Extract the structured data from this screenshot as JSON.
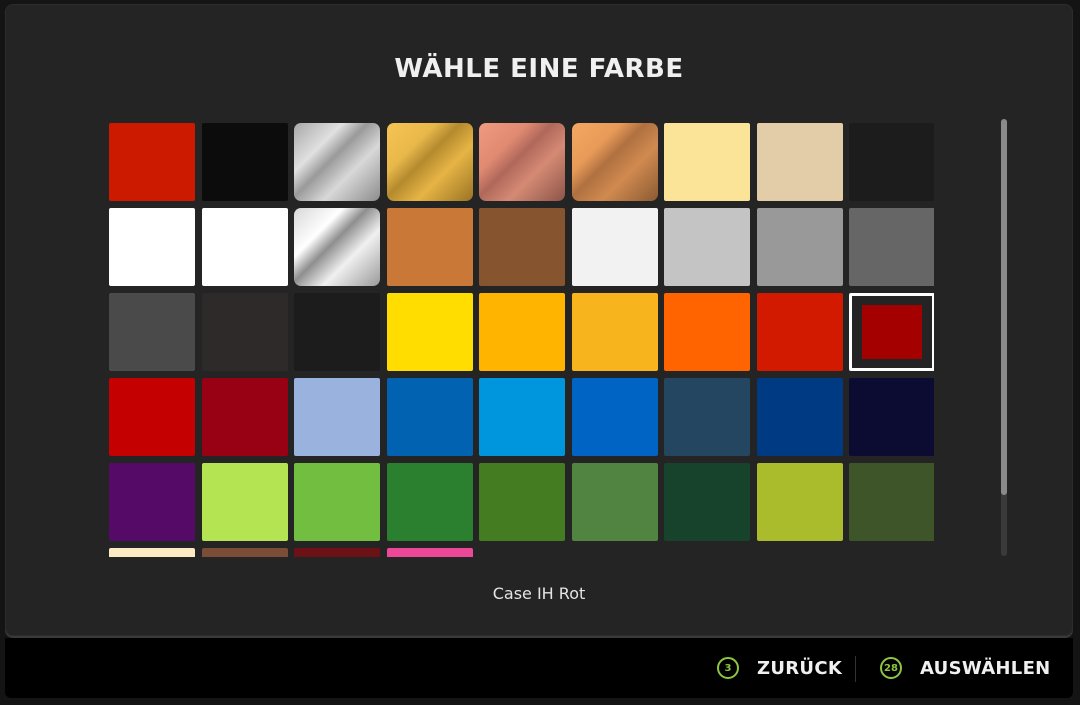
{
  "dialog": {
    "title": "WÄHLE EINE FARBE",
    "selected_color_name": "Case IH Rot",
    "selected_index": 26
  },
  "swatches": [
    {
      "color": "#cc1a00",
      "type": "solid"
    },
    {
      "color": "#0c0c0c",
      "type": "solid"
    },
    {
      "color": "silver",
      "type": "metallic",
      "gradient": [
        "#a8a8a8",
        "#e0e0e0",
        "#9a9a9a",
        "#d8d8d8",
        "#8c8c8c"
      ]
    },
    {
      "color": "gold",
      "type": "metallic",
      "gradient": [
        "#f6c453",
        "#e8b84a",
        "#b48a2e",
        "#e6b445",
        "#9a7424"
      ]
    },
    {
      "color": "rose-gold",
      "type": "metallic",
      "gradient": [
        "#f09a80",
        "#e08a72",
        "#b0685a",
        "#d48a74",
        "#8c5448"
      ]
    },
    {
      "color": "copper",
      "type": "metallic",
      "gradient": [
        "#f4a862",
        "#e89a58",
        "#b07040",
        "#d08a50",
        "#8a5a32"
      ]
    },
    {
      "color": "#fbe498",
      "type": "solid"
    },
    {
      "color": "#e2cda8",
      "type": "solid"
    },
    {
      "color": "#1c1c1c",
      "type": "solid"
    },
    {
      "color": "#ffffff",
      "type": "solid"
    },
    {
      "color": "#ffffff",
      "type": "solid"
    },
    {
      "color": "chrome",
      "type": "metallic",
      "gradient": [
        "#d8d8d8",
        "#ffffff",
        "#8e8e8e",
        "#f0f0f0",
        "#9a9a9a"
      ]
    },
    {
      "color": "#c97838",
      "type": "solid"
    },
    {
      "color": "#875430",
      "type": "solid"
    },
    {
      "color": "#f2f2f2",
      "type": "solid"
    },
    {
      "color": "#c4c4c4",
      "type": "solid"
    },
    {
      "color": "#999999",
      "type": "solid"
    },
    {
      "color": "#666666",
      "type": "solid"
    },
    {
      "color": "#4a4a4a",
      "type": "solid"
    },
    {
      "color": "#2e2a29",
      "type": "solid"
    },
    {
      "color": "#1c1c1c",
      "type": "solid"
    },
    {
      "color": "#ffdd00",
      "type": "solid"
    },
    {
      "color": "#ffb500",
      "type": "solid"
    },
    {
      "color": "#f8b41c",
      "type": "solid"
    },
    {
      "color": "#ff6400",
      "type": "solid"
    },
    {
      "color": "#d11a00",
      "type": "solid"
    },
    {
      "color": "#a50000",
      "type": "solid"
    },
    {
      "color": "#c40000",
      "type": "solid"
    },
    {
      "color": "#980014",
      "type": "solid"
    },
    {
      "color": "#9ab2de",
      "type": "solid"
    },
    {
      "color": "#0062b0",
      "type": "solid"
    },
    {
      "color": "#0096de",
      "type": "solid"
    },
    {
      "color": "#0064c4",
      "type": "solid"
    },
    {
      "color": "#254660",
      "type": "solid"
    },
    {
      "color": "#003a82",
      "type": "solid"
    },
    {
      "color": "#0c0c32",
      "type": "solid"
    },
    {
      "color": "#550a68",
      "type": "solid"
    },
    {
      "color": "#b4e452",
      "type": "solid"
    },
    {
      "color": "#72be40",
      "type": "solid"
    },
    {
      "color": "#2b8030",
      "type": "solid"
    },
    {
      "color": "#447c22",
      "type": "solid"
    },
    {
      "color": "#508440",
      "type": "solid"
    },
    {
      "color": "#17422c",
      "type": "solid"
    },
    {
      "color": "#aabc2c",
      "type": "solid"
    },
    {
      "color": "#3e552a",
      "type": "solid"
    },
    {
      "color": "#fde9c4",
      "type": "solid"
    },
    {
      "color": "#7a4e36",
      "type": "solid"
    },
    {
      "color": "#6c1216",
      "type": "solid"
    },
    {
      "color": "#ec4898",
      "type": "solid"
    }
  ],
  "scrollbar": {
    "position_fraction": 0.0,
    "visible_fraction": 0.86
  },
  "footer": {
    "back": {
      "key": "3",
      "label": "ZURÜCK"
    },
    "select": {
      "key": "28",
      "label": "AUSWÄHLEN"
    }
  },
  "colors": {
    "accent": "#8dc63f",
    "panel_bg": "#242424",
    "footer_bg": "#000000",
    "selection_border": "#ffffff"
  }
}
